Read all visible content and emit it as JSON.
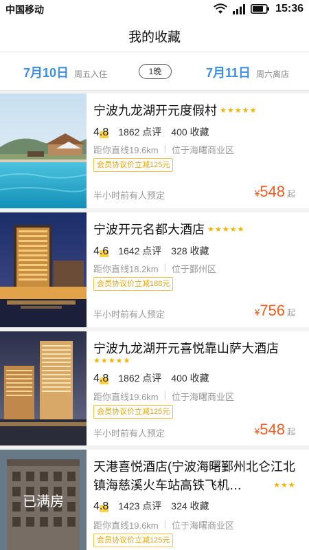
{
  "status_bar": {
    "carrier": "中国移动",
    "time": "15:36"
  },
  "header": {
    "title": "我的收藏"
  },
  "dates": {
    "checkin_date": "7月10日",
    "checkin_label": "周五入住",
    "nights": "1晚",
    "checkout_date": "7月11日",
    "checkout_label": "周六离店"
  },
  "hotels": [
    {
      "name": "宁波九龙湖开元度假村",
      "stars": "★★★★★",
      "score_int": "4",
      "score_dec": ".8",
      "reviews": "1862 点评",
      "favorites": "400 收藏",
      "distance": "距你直线19.6km",
      "area": "位于海曙商业区",
      "promo": "会员协议价立减125元",
      "booked": "半小时前有人预定",
      "currency": "¥",
      "price": "548",
      "price_suffix": "起"
    },
    {
      "name": "宁波开元名都大酒店",
      "stars": "★★★★★",
      "score_int": "4",
      "score_dec": ".6",
      "reviews": "1642 点评",
      "favorites": "328 收藏",
      "distance": "距你直线18.2km",
      "area": "位于鄞州区",
      "promo": "会员协议价立减188元",
      "booked": "半小时前有人预定",
      "currency": "¥",
      "price": "756",
      "price_suffix": "起"
    },
    {
      "name": "宁波九龙湖开元喜悦靠山萨大酒店",
      "stars": "★★★★★",
      "score_int": "4",
      "score_dec": ".8",
      "reviews": "1862 点评",
      "favorites": "400 收藏",
      "distance": "距你直线19.6km",
      "area": "位于海曙商业区",
      "promo": "会员协议价立减125元",
      "booked": "半小时前有人预定",
      "currency": "¥",
      "price": "548",
      "price_suffix": "起"
    },
    {
      "name": "天港喜悦酒店(宁波海曙鄞州北仑江北镇海慈溪火车站高铁飞机…",
      "stars": "★★★",
      "score_int": "4",
      "score_dec": ".8",
      "reviews": "1423 点评",
      "favorites": "324 收藏",
      "distance": "距你直线19.6km",
      "area": "位于海曙商业区",
      "promo": "会员协议价立减125元",
      "status_overlay": "已满房"
    }
  ],
  "colors": {
    "accent_blue": "#3a8ee6",
    "price_orange": "#f25c1e",
    "star_gold": "#f5b300"
  }
}
